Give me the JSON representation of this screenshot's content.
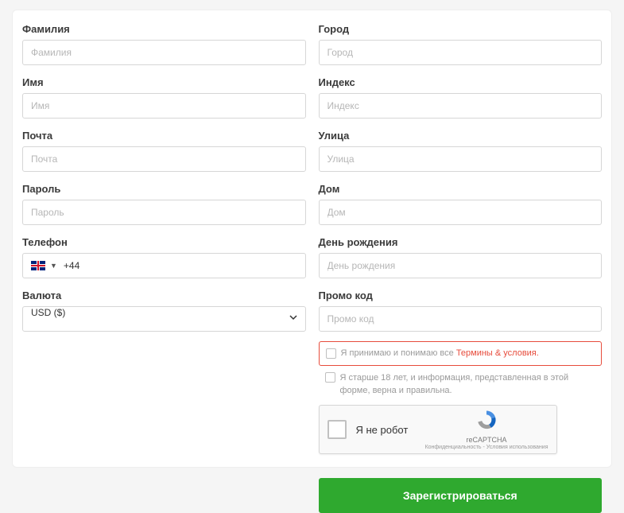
{
  "left": {
    "surname": {
      "label": "Фамилия",
      "placeholder": "Фамилия"
    },
    "name": {
      "label": "Имя",
      "placeholder": "Имя"
    },
    "email": {
      "label": "Почта",
      "placeholder": "Почта"
    },
    "password": {
      "label": "Пароль",
      "placeholder": "Пароль"
    },
    "phone": {
      "label": "Телефон",
      "dial": "+44"
    },
    "currency": {
      "label": "Валюта",
      "value": "USD ($)"
    }
  },
  "right": {
    "city": {
      "label": "Город",
      "placeholder": "Город"
    },
    "index": {
      "label": "Индекс",
      "placeholder": "Индекс"
    },
    "street": {
      "label": "Улица",
      "placeholder": "Улица"
    },
    "house": {
      "label": "Дом",
      "placeholder": "Дом"
    },
    "dob": {
      "label": "День рождения",
      "placeholder": "День рождения"
    },
    "promo": {
      "label": "Промо код",
      "placeholder": "Промо код"
    }
  },
  "terms": {
    "prefix": "Я принимаю и понимаю все ",
    "link": "Термины & условия."
  },
  "age_text": "Я старше 18 лет, и информация, представленная в этой форме, верна и правильна.",
  "recaptcha": {
    "label": "Я не робот",
    "brand": "reCAPTCHA",
    "legal": "Конфиденциальность - Условия использования"
  },
  "submit_label": "Зарегистрироваться"
}
